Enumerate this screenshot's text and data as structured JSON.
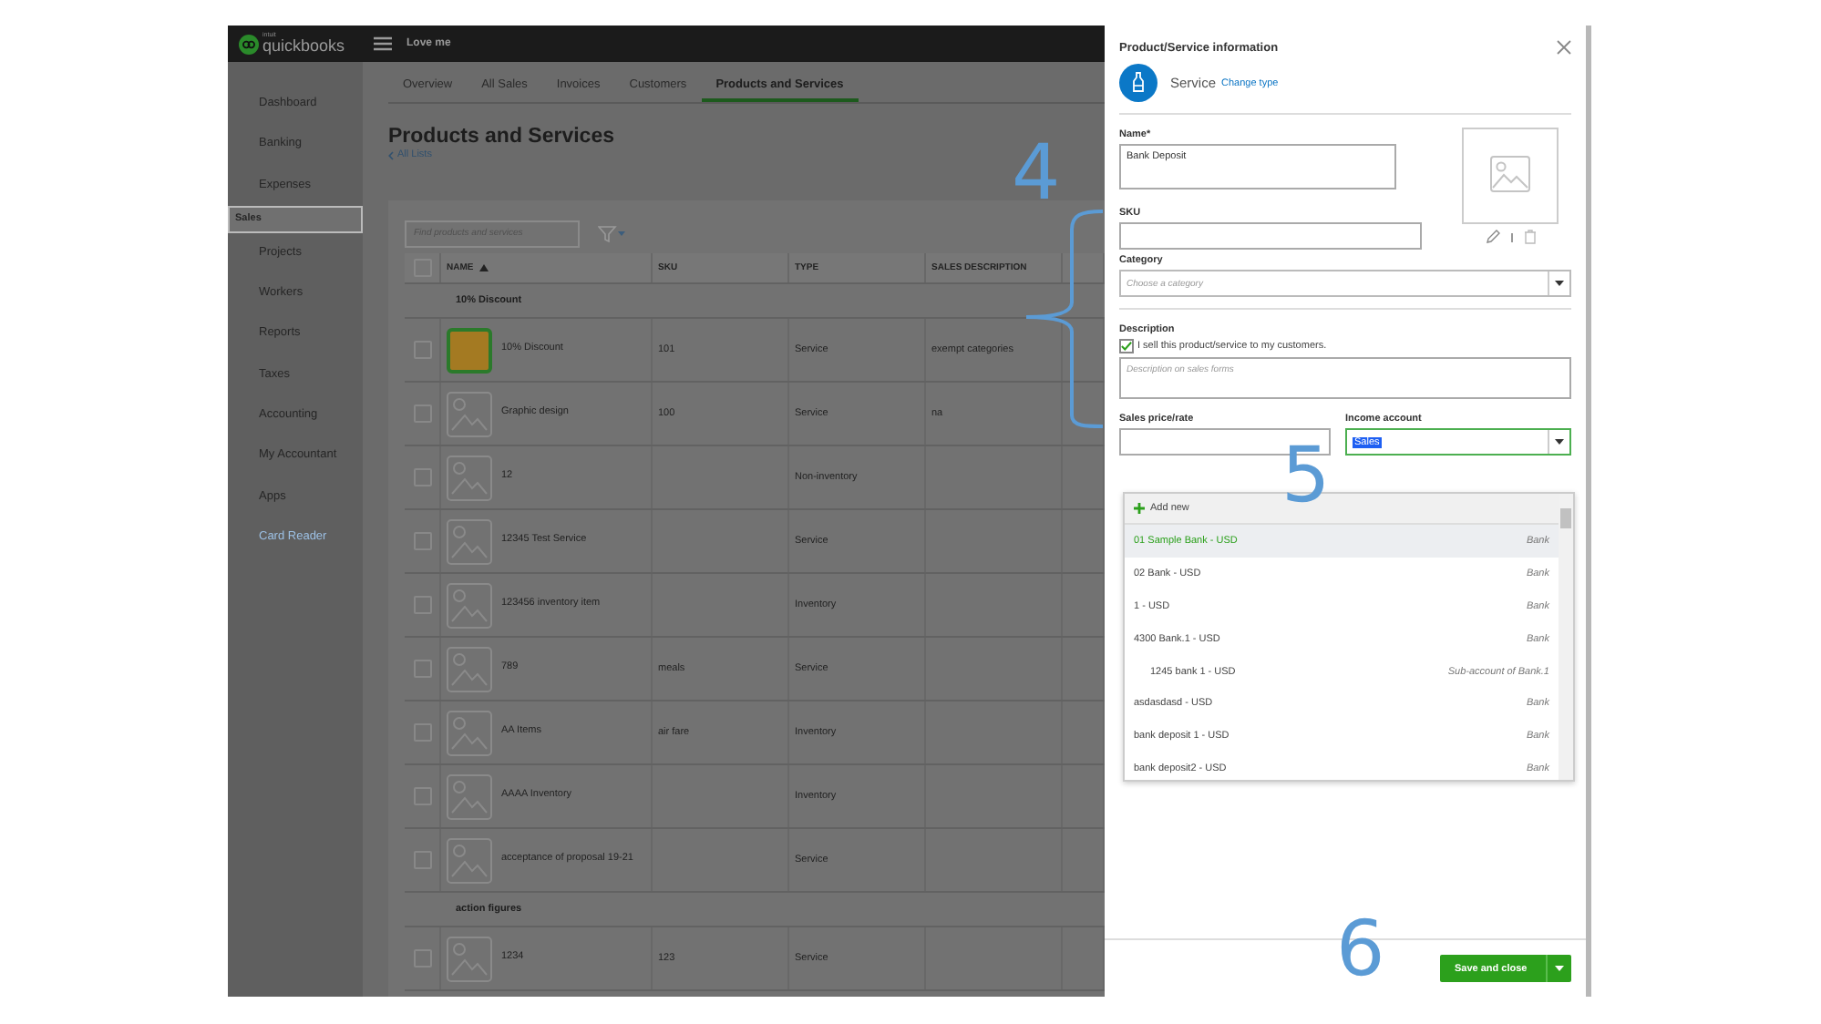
{
  "app": {
    "brand_small": "intuit",
    "brand": "quickbooks",
    "company": "Love me"
  },
  "sidebar": {
    "items": [
      {
        "label": "Dashboard",
        "selected": false,
        "kind": "nav"
      },
      {
        "label": "Banking",
        "selected": false,
        "kind": "nav"
      },
      {
        "label": "Expenses",
        "selected": false,
        "kind": "nav"
      },
      {
        "label": "Sales",
        "selected": true,
        "kind": "nav"
      },
      {
        "label": "Projects",
        "selected": false,
        "kind": "nav"
      },
      {
        "label": "Workers",
        "selected": false,
        "kind": "nav"
      },
      {
        "label": "Reports",
        "selected": false,
        "kind": "nav"
      },
      {
        "label": "Taxes",
        "selected": false,
        "kind": "nav"
      },
      {
        "label": "Accounting",
        "selected": false,
        "kind": "nav"
      },
      {
        "label": "My Accountant",
        "selected": false,
        "kind": "nav"
      },
      {
        "label": "Apps",
        "selected": false,
        "kind": "nav"
      },
      {
        "label": "Card Reader",
        "selected": false,
        "kind": "link"
      }
    ]
  },
  "tabs": [
    {
      "label": "Overview",
      "selected": false
    },
    {
      "label": "All Sales",
      "selected": false
    },
    {
      "label": "Invoices",
      "selected": false
    },
    {
      "label": "Customers",
      "selected": false
    },
    {
      "label": "Products and Services",
      "selected": true
    }
  ],
  "page": {
    "title": "Products and Services",
    "back_link": "All Lists"
  },
  "table": {
    "search": {
      "placeholder": "Find products and services"
    },
    "select_all_checked": false,
    "columns": [
      "NAME",
      "SKU",
      "TYPE",
      "SALES DESCRIPTION"
    ],
    "rows": [
      {
        "kind": "group",
        "name": "10% Discount"
      },
      {
        "kind": "item",
        "checked": false,
        "has_photo": true,
        "name": "10% Discount",
        "sku": "101",
        "type": "Service",
        "sales_description": "exempt categories"
      },
      {
        "kind": "item",
        "checked": false,
        "has_photo": false,
        "name": "Graphic design",
        "sku": "100",
        "type": "Service",
        "sales_description": "na"
      },
      {
        "kind": "item",
        "checked": false,
        "has_photo": false,
        "name": "12",
        "type": "Non-inventory"
      },
      {
        "kind": "item",
        "checked": false,
        "has_photo": false,
        "name": "12345 Test Service",
        "type": "Service"
      },
      {
        "kind": "item",
        "checked": false,
        "has_photo": false,
        "name": "123456 inventory item",
        "type": "Inventory"
      },
      {
        "kind": "item",
        "checked": false,
        "has_photo": false,
        "name": "789",
        "sku": "meals",
        "type": "Service"
      },
      {
        "kind": "item",
        "checked": false,
        "has_photo": false,
        "name": "AA Items",
        "sku": "air fare",
        "type": "Inventory"
      },
      {
        "kind": "item",
        "checked": false,
        "has_photo": false,
        "name": "AAAA Inventory",
        "type": "Inventory"
      },
      {
        "kind": "item",
        "checked": false,
        "has_photo": false,
        "name": "acceptance of proposal 19-21",
        "type": "Service"
      },
      {
        "kind": "group",
        "name": "action figures"
      },
      {
        "kind": "item",
        "checked": false,
        "has_photo": false,
        "name": "1234",
        "sku": "123",
        "type": "Service"
      }
    ]
  },
  "panel": {
    "title": "Product/Service information",
    "type": "Service",
    "change_type": "Change type",
    "name": {
      "label": "Name*",
      "value": "Bank Deposit"
    },
    "sku": {
      "label": "SKU"
    },
    "category": {
      "label": "Category",
      "placeholder": "Choose a category"
    },
    "description": {
      "label": "Description",
      "sell_checkbox": {
        "label": "I sell this product/service to my customers.",
        "checked": true
      },
      "placeholder": "Description on sales forms"
    },
    "sales_price": {
      "label": "Sales price/rate"
    },
    "income_account": {
      "label": "Income account",
      "value": "Sales"
    },
    "dropdown": {
      "add_new": "Add new",
      "options": [
        {
          "name": "01 Sample Bank - USD",
          "type": "Bank",
          "selected": true
        },
        {
          "name": "02 Bank - USD",
          "type": "Bank",
          "selected": false
        },
        {
          "name": "1 - USD",
          "type": "Bank",
          "selected": false
        },
        {
          "name": "4300 Bank.1 - USD",
          "type": "Bank",
          "selected": false,
          "children": [
            {
              "name": "1245 bank 1 - USD",
              "type": "Sub-account of Bank.1",
              "selected": false
            }
          ]
        },
        {
          "name": "asdasdasd - USD",
          "type": "Bank",
          "selected": false
        },
        {
          "name": "bank deposit 1 - USD",
          "type": "Bank",
          "selected": false
        },
        {
          "name": "bank deposit2 - USD",
          "type": "Bank",
          "selected": false
        }
      ]
    },
    "save_button": "Save and close"
  },
  "annotations": [
    {
      "label": "4"
    },
    {
      "label": "5"
    },
    {
      "label": "6"
    }
  ]
}
